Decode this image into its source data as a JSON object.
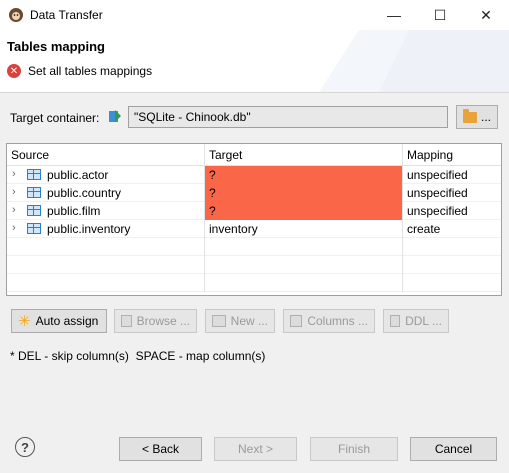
{
  "window": {
    "title": "Data Transfer",
    "controls": {
      "minimize": "—",
      "maximize": "☐",
      "close": "✕"
    }
  },
  "header": {
    "title": "Tables mapping",
    "message": "Set all tables mappings",
    "message_icon": "error-icon"
  },
  "target": {
    "label": "Target container:",
    "value": "\"SQLite - Chinook.db\"",
    "browse_label": "..."
  },
  "table": {
    "columns": [
      "Source",
      "Target",
      "Mapping"
    ],
    "rows": [
      {
        "source": "public.actor",
        "target": "?",
        "mapping": "unspecified",
        "target_warning": true
      },
      {
        "source": "public.country",
        "target": "?",
        "mapping": "unspecified",
        "target_warning": true
      },
      {
        "source": "public.film",
        "target": "?",
        "mapping": "unspecified",
        "target_warning": true
      },
      {
        "source": "public.inventory",
        "target": "inventory",
        "mapping": "create",
        "target_warning": false
      }
    ],
    "warning_color": "#fa6748"
  },
  "actions": {
    "auto_assign": "Auto assign",
    "browse": "Browse ...",
    "new": "New ...",
    "columns": "Columns ...",
    "ddl": "DDL ..."
  },
  "hint": "* DEL - skip column(s)  SPACE - map column(s)",
  "footer": {
    "back": "< Back",
    "next": "Next >",
    "finish": "Finish",
    "cancel": "Cancel"
  }
}
